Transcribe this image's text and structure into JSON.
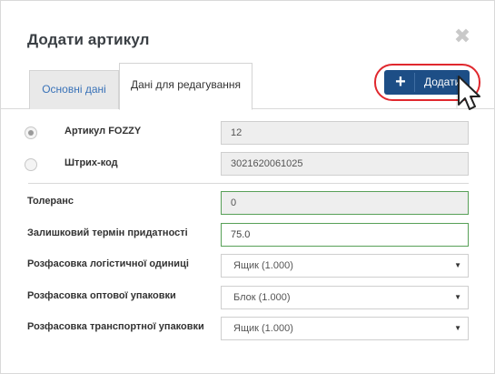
{
  "dialog": {
    "title": "Додати артикул",
    "close_glyph": "✖"
  },
  "tabs": [
    {
      "label": "Основні дані",
      "active": false
    },
    {
      "label": "Дані для редагування",
      "active": true
    }
  ],
  "add_button": {
    "label": "Додати",
    "icon": "plus-icon",
    "highlighted": true
  },
  "form": {
    "article_fozzy": {
      "label": "Артикул FOZZY",
      "value": "12",
      "selected": true
    },
    "barcode": {
      "label": "Штрих-код",
      "value": "3021620061025",
      "selected": false
    },
    "tolerance": {
      "label": "Толеранс",
      "value": "0"
    },
    "shelf_life": {
      "label": "Залишковий термін придатності",
      "value": "75.0"
    },
    "logistic_unit": {
      "label": "Розфасовка логістичної одиниці",
      "value": "Ящик (1.000)"
    },
    "wholesale_pack": {
      "label": "Розфасовка оптової упаковки",
      "value": "Блок (1.000)"
    },
    "transport_pack": {
      "label": "Розфасовка транспортної упаковки",
      "value": "Ящик (1.000)"
    }
  },
  "colors": {
    "primary_button": "#1d4e86",
    "highlight_ring": "#e0282e",
    "valid_border": "#58a058",
    "active_tab_text": "#3a73b8"
  }
}
